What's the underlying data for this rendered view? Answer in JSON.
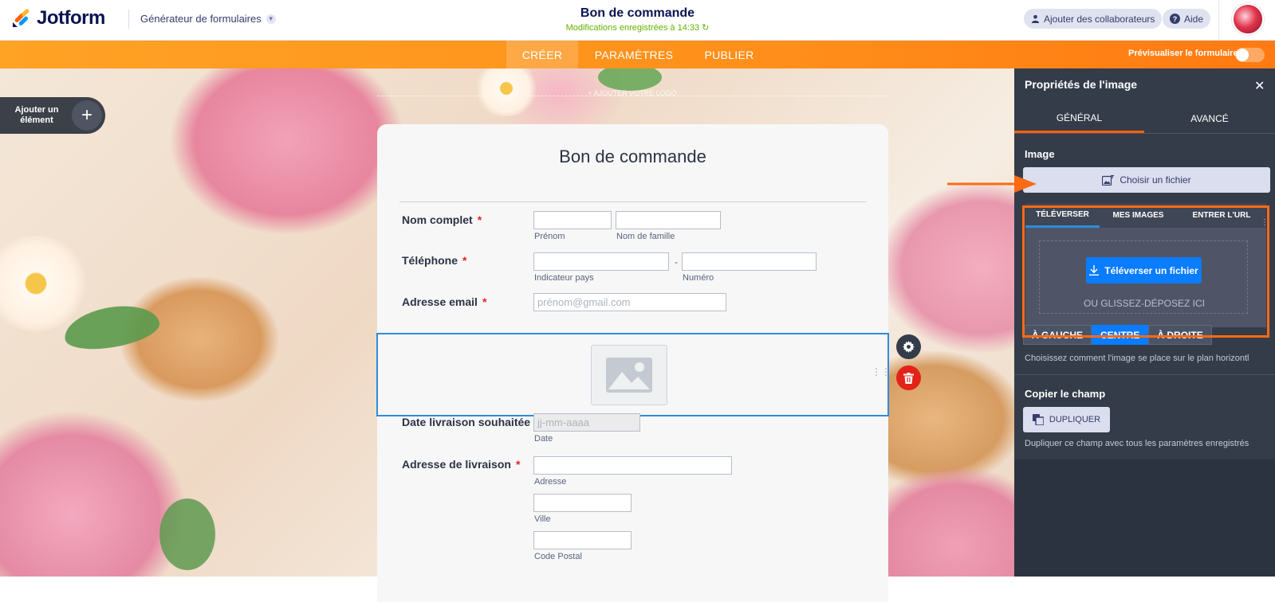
{
  "header": {
    "logo_text": "Jotform",
    "builder_label": "Générateur de formulaires",
    "form_title": "Bon de commande",
    "save_status": "Modifications enregistrées à 14:33 ↻",
    "collab_label": "Ajouter des collaborateurs",
    "help_label": "Aide"
  },
  "nav": {
    "tabs": [
      {
        "label": "CRÉER",
        "active": true
      },
      {
        "label": "PARAMÈTRES",
        "active": false
      },
      {
        "label": "PUBLIER",
        "active": false
      }
    ],
    "preview_label": "Prévisualiser le formulaire"
  },
  "canvas": {
    "add_element_label": "Ajouter un élément",
    "add_logo_label": "+ AJOUTER VOTRE LOGO"
  },
  "form": {
    "heading": "Bon de commande",
    "fields": {
      "name": {
        "label": "Nom complet",
        "sub_first": "Prénom",
        "sub_last": "Nom de famille"
      },
      "phone": {
        "label": "Téléphone",
        "sub_code": "Indicateur pays",
        "sub_number": "Numéro",
        "dash": "-"
      },
      "email": {
        "label": "Adresse email",
        "placeholder": "prénom@gmail.com"
      },
      "date": {
        "label": "Date livraison souhaitée",
        "placeholder": "jj-mm-aaaa",
        "sub": "Date"
      },
      "address": {
        "label": "Adresse de livraison",
        "sub_street": "Adresse",
        "sub_city": "Ville",
        "sub_zip": "Code Postal"
      }
    },
    "required_mark": "*"
  },
  "panel": {
    "title": "Propriétés de l'image",
    "close": "✕",
    "tabs": [
      {
        "label": "GÉNÉRAL",
        "active": true
      },
      {
        "label": "AVANCÉ",
        "active": false
      }
    ],
    "image_section": "Image",
    "choose_file": "Choisir un fichier",
    "upload_tabs": [
      {
        "label": "TÉLÉVERSER",
        "active": true
      },
      {
        "label": "MES IMAGES",
        "active": false
      },
      {
        "label": "ENTRER L'URL",
        "active": false
      }
    ],
    "upload_button": "Téléverser un fichier",
    "drop_label": "OU GLISSEZ-DÉPOSEZ ICI",
    "align_buttons": [
      {
        "label": "À GAUCHE",
        "active": false
      },
      {
        "label": "CENTRE",
        "active": true
      },
      {
        "label": "À DROITE",
        "active": false
      }
    ],
    "align_hint": "Choisissez comment l'image se place sur le plan horizontl",
    "copy_section": "Copier le champ",
    "duplicate_button": "DUPLIQUER",
    "duplicate_hint": "Dupliquer ce champ avec tous les paramètres enregistrés"
  },
  "colors": {
    "brand_orange": "#ff7a12",
    "panel_bg": "#343c49",
    "accent_blue": "#0a7cff",
    "highlight_frame": "#ff6a13",
    "selection_border": "#2f8cd9"
  }
}
